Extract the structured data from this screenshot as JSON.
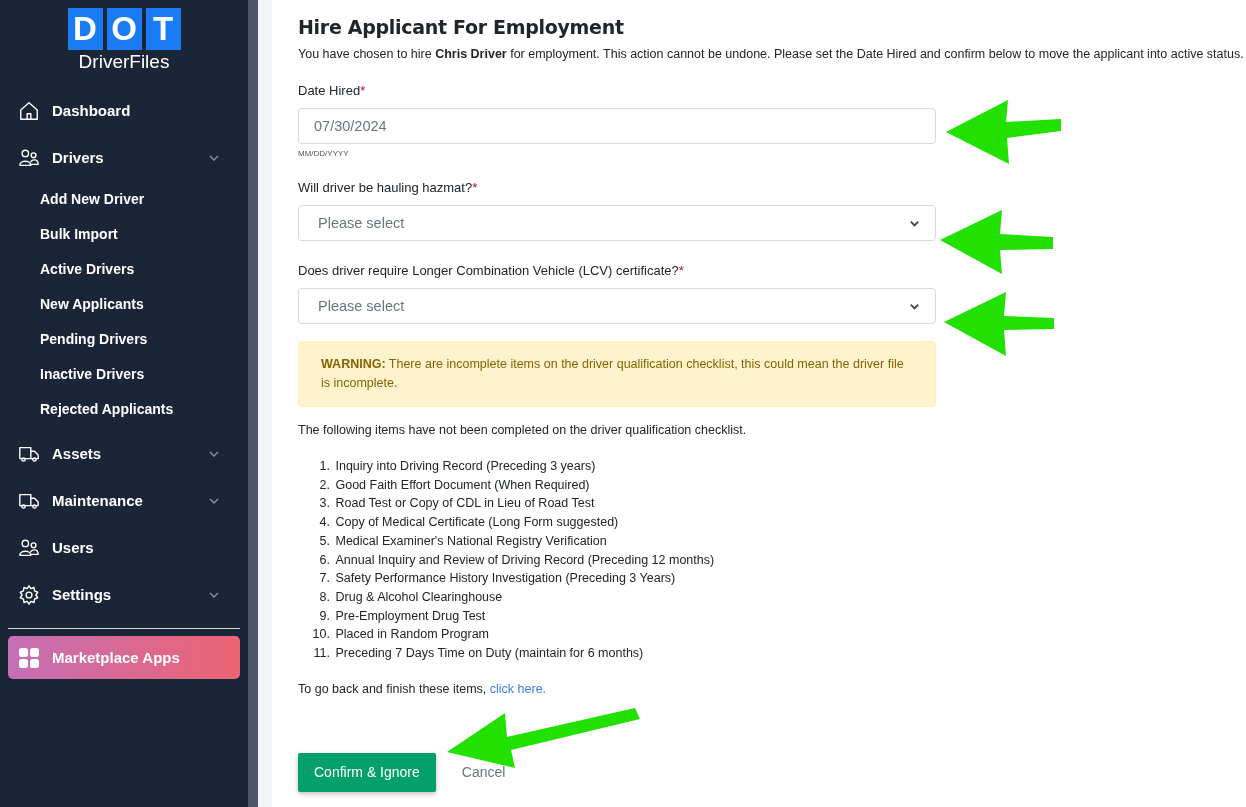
{
  "sidebar": {
    "logo": {
      "letters": [
        "D",
        "O",
        "T"
      ],
      "name": "DriverFiles"
    },
    "items": [
      {
        "kind": "link",
        "label": "Dashboard"
      },
      {
        "kind": "group",
        "label": "Drivers",
        "children": [
          {
            "label": "Add New Driver"
          },
          {
            "label": "Bulk Import"
          },
          {
            "label": "Active Drivers"
          },
          {
            "label": "New Applicants"
          },
          {
            "label": "Pending Drivers"
          },
          {
            "label": "Inactive Drivers"
          },
          {
            "label": "Rejected Applicants"
          }
        ]
      },
      {
        "kind": "group",
        "label": "Assets"
      },
      {
        "kind": "group",
        "label": "Maintenance"
      },
      {
        "kind": "link",
        "label": "Users"
      },
      {
        "kind": "group",
        "label": "Settings"
      }
    ],
    "featured": {
      "label": "Marketplace Apps"
    }
  },
  "form": {
    "title": "Hire Applicant For Employment",
    "intro": "You have chosen to hire **Chris Driver** for employment. This action cannot be undone. Please set the Date Hired and confirm below to move the applicant into active status.",
    "fields": [
      {
        "kind": "date",
        "label": "Date Hired",
        "required_mark": "*",
        "value": "07/30/2024",
        "hint": "MM/DD/YYYY"
      },
      {
        "kind": "select",
        "label": "Will driver be hauling hazmat?",
        "required_mark": "*",
        "placeholder": "Please select"
      },
      {
        "kind": "select",
        "label": "Does driver require Longer Combination Vehicle (LCV) certificate?",
        "required_mark": "*",
        "placeholder": "Please select"
      }
    ],
    "warning": "**WARNING:** There are incomplete items on the driver qualification checklist, this could mean the driver file is incomplete.",
    "checklist_intro": "The following items have not been completed on the driver qualification checklist.",
    "checklist": [
      {
        "number": "1.",
        "text": "Inquiry into Driving Record (Preceding 3 years)"
      },
      {
        "number": "2.",
        "text": "Good Faith Effort Document (When Required)"
      },
      {
        "number": "3.",
        "text": "Road Test or Copy of CDL in Lieu of Road Test"
      },
      {
        "number": "4.",
        "text": "Copy of Medical Certificate (Long Form suggested)"
      },
      {
        "number": "5.",
        "text": "Medical Examiner's National Registry Verification"
      },
      {
        "number": "6.",
        "text": "Annual Inquiry and Review of Driving Record (Preceding 12 months)"
      },
      {
        "number": "7.",
        "text": "Safety Performance History Investigation (Preceding 3 Years)"
      },
      {
        "number": "8.",
        "text": "Drug & Alcohol Clearinghouse"
      },
      {
        "number": "9.",
        "text": "Pre-Employment Drug Test"
      },
      {
        "number": "10.",
        "text": "Placed in Random Program"
      },
      {
        "number": "11.",
        "text": "Preceding 7 Days Time on Duty (maintain for 6 months)"
      }
    ],
    "back_text": "To go back and finish these items,",
    "back_link": "click here.",
    "confirm": "Confirm & Ignore",
    "cancel": "Cancel"
  }
}
